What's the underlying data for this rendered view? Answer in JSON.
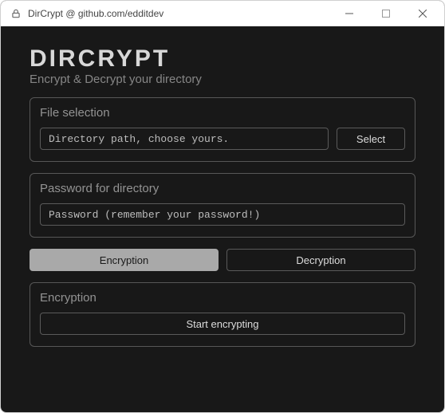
{
  "window": {
    "title": "DirCrypt @ github.com/edditdev"
  },
  "header": {
    "app_title": "DIRCRYPT",
    "subtitle": "Encrypt & Decrypt your directory"
  },
  "file_selection": {
    "title": "File selection",
    "path_placeholder": "Directory path, choose yours.",
    "path_value": "",
    "select_label": "Select"
  },
  "password_section": {
    "title": "Password for directory",
    "placeholder": "Password (remember your password!)",
    "value": ""
  },
  "tabs": {
    "encryption_label": "Encryption",
    "decryption_label": "Decryption",
    "active": "encryption"
  },
  "action_panel": {
    "title": "Encryption",
    "start_label": "Start encrypting"
  }
}
